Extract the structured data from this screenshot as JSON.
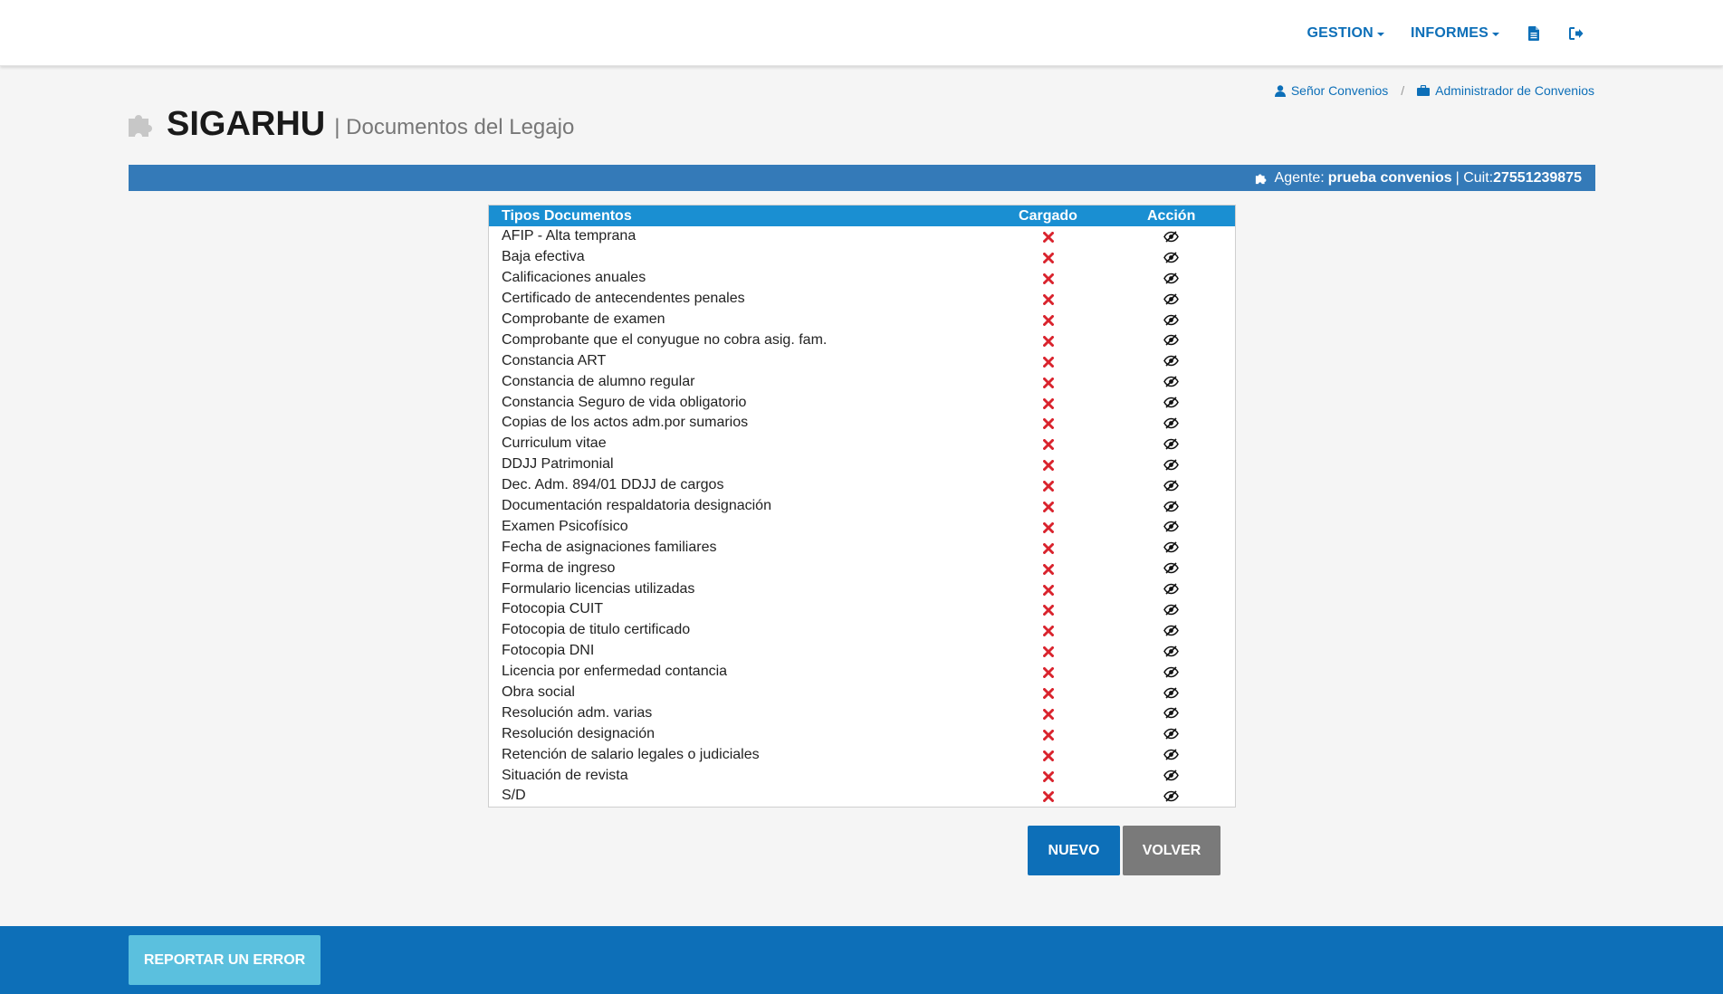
{
  "nav": {
    "gestion_label": "GESTION",
    "informes_label": "INFORMES",
    "document_icon": "document-icon",
    "logout_icon": "sign-out-icon"
  },
  "header": {
    "app_name": "SIGARHU",
    "subtitle": "| Documentos del Legajo",
    "logo_icon": "puzzle-icon"
  },
  "breadcrumb": {
    "user_label": "Señor Convenios",
    "role_label": "Administrador de Convenios",
    "separator": "/"
  },
  "agent": {
    "agent_label": "Agente:",
    "agent_name": "prueba convenios",
    "cuit_label": "| Cuit:",
    "cuit_value": "27551239875"
  },
  "table": {
    "headers": {
      "name": "Tipos Documentos",
      "loaded": "Cargado",
      "action": "Acción"
    },
    "rows": [
      "AFIP - Alta temprana",
      "Baja efectiva",
      "Calificaciones anuales",
      "Certificado de antecendentes penales",
      "Comprobante de examen",
      "Comprobante que el conyugue no cobra asig. fam.",
      "Constancia ART",
      "Constancia de alumno regular",
      "Constancia Seguro de vida obligatorio",
      "Copias de los actos adm.por sumarios",
      "Curriculum vitae",
      "DDJJ Patrimonial",
      "Dec. Adm. 894/01 DDJJ de cargos",
      "Documentación respaldatoria designación",
      "Examen Psicofísico",
      "Fecha de asignaciones familiares",
      "Forma de ingreso",
      "Formulario licencias utilizadas",
      "Fotocopia CUIT",
      "Fotocopia de titulo certificado",
      "Fotocopia DNI",
      "Licencia por enfermedad contancia",
      "Obra social",
      "Resolución adm. varias",
      "Resolución designación",
      "Retención de salario legales o judiciales",
      "Situación de revista",
      "S/D"
    ]
  },
  "buttons": {
    "nuevo": "NUEVO",
    "volver": "VOLVER",
    "report": "REPORTAR UN ERROR"
  },
  "colors": {
    "primary": "#0d6fb8",
    "agent_bar": "#347ab8",
    "table_header": "#1a8fd2",
    "not_loaded": "#d9232d",
    "report_button": "#5bc0de",
    "secondary_button": "#7a7a7a"
  }
}
